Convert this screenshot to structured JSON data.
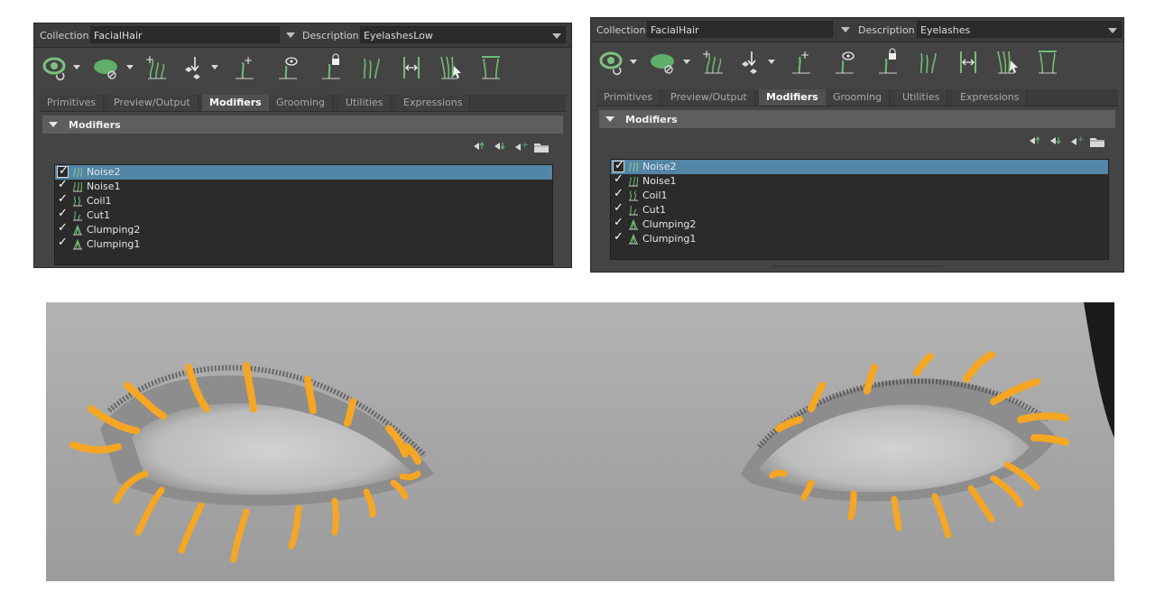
{
  "panels": [
    {
      "collection_label": "Collection",
      "collection_value": "FacialHair",
      "description_label": "Description",
      "description_value": "EyelashesLow",
      "tabs": [
        "Primitives",
        "Preview/Output",
        "Modifiers",
        "Grooming",
        "Utilities",
        "Expressions"
      ],
      "active_tab": "Modifiers",
      "section_title": "Modifiers",
      "modifiers": [
        {
          "name": "Noise2",
          "checked": true,
          "selected": true,
          "icon": "noise-icon"
        },
        {
          "name": "Noise1",
          "checked": true,
          "selected": false,
          "icon": "noise-icon"
        },
        {
          "name": "Coil1",
          "checked": true,
          "selected": false,
          "icon": "coil-icon"
        },
        {
          "name": "Cut1",
          "checked": true,
          "selected": false,
          "icon": "cut-icon"
        },
        {
          "name": "Clumping2",
          "checked": true,
          "selected": false,
          "icon": "clumping-icon"
        },
        {
          "name": "Clumping1",
          "checked": true,
          "selected": false,
          "icon": "clumping-icon"
        }
      ]
    },
    {
      "collection_label": "Collection",
      "collection_value": "FacialHair",
      "description_label": "Description",
      "description_value": "Eyelashes",
      "tabs": [
        "Primitives",
        "Preview/Output",
        "Modifiers",
        "Grooming",
        "Utilities",
        "Expressions"
      ],
      "active_tab": "Modifiers",
      "section_title": "Modifiers",
      "modifiers": [
        {
          "name": "Noise2",
          "checked": true,
          "selected": true,
          "icon": "noise-icon"
        },
        {
          "name": "Noise1",
          "checked": true,
          "selected": false,
          "icon": "noise-icon"
        },
        {
          "name": "Coil1",
          "checked": true,
          "selected": false,
          "icon": "coil-icon"
        },
        {
          "name": "Cut1",
          "checked": true,
          "selected": false,
          "icon": "cut-icon"
        },
        {
          "name": "Clumping2",
          "checked": true,
          "selected": false,
          "icon": "clumping-icon"
        },
        {
          "name": "Clumping1",
          "checked": true,
          "selected": false,
          "icon": "clumping-icon"
        }
      ]
    }
  ],
  "toolbar_icons": [
    "preview-eye-icon",
    "hide-icon",
    "add-guide-icon",
    "move-guide-icon",
    "add-point-icon",
    "toggle-guide-icon",
    "lock-guide-icon",
    "guide-length-icon",
    "guide-spread-icon",
    "select-guide-icon",
    "guide-toggle-icon"
  ],
  "modifier_stack_icons": [
    "move-up-icon",
    "move-down-icon",
    "add-modifier-icon",
    "folder-icon"
  ],
  "colors": {
    "panel_bg": "#444444",
    "selection": "#5285a6",
    "icon_green": "#5fae6a",
    "guide_orange": "#f5a623",
    "skin": "#a9a9a9"
  },
  "viewport": {
    "content": "3D viewport showing eyelash guides on a grey face mesh",
    "guide_color": "#f5a623"
  }
}
